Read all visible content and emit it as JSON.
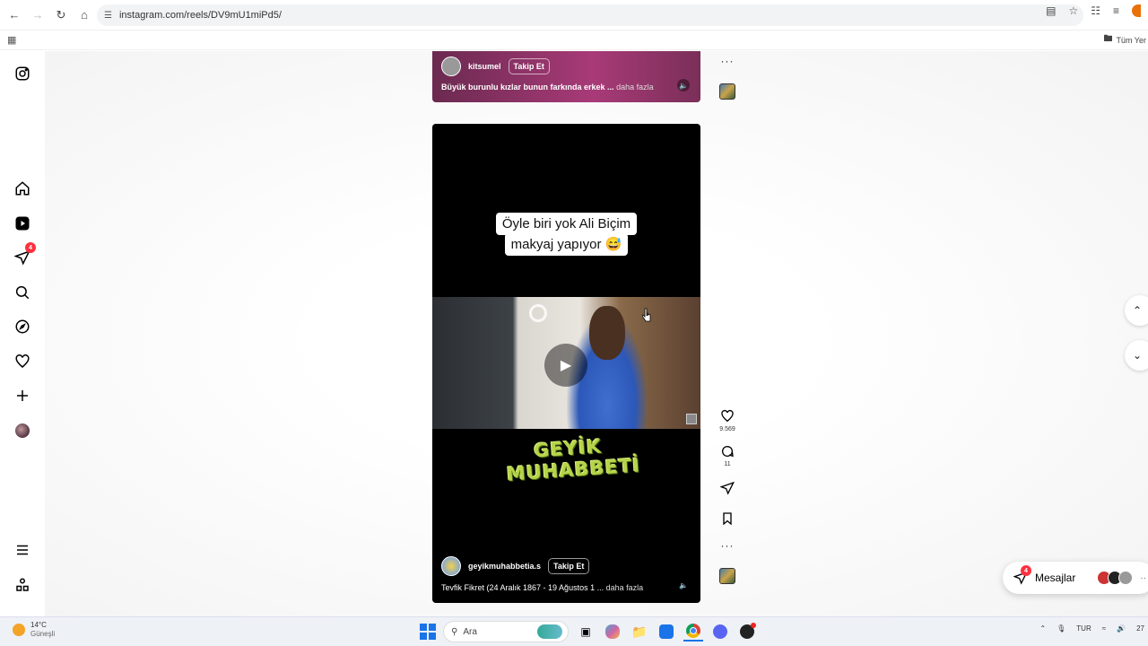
{
  "browser": {
    "url": "instagram.com/reels/DV9mU1miPd5/",
    "bookmarks_folder": "Tüm Yer"
  },
  "sidebar": {
    "notifications_badge": "4"
  },
  "prev_reel": {
    "username": "kitsumel",
    "follow_label": "Takip Et",
    "caption": "Büyük burunlu kızlar bunun farkında erkek ...",
    "more_label": "daha fazla"
  },
  "reel": {
    "overlay_line1": "Öyle biri yok Ali Biçim",
    "overlay_line2": "makyaj yapıyor 😅",
    "logo_line1": "GEYİK",
    "logo_line2": "MUHABBETİ",
    "username": "geyikmuhabbetia.s",
    "follow_label": "Takip Et",
    "caption": "Tevfik Fikret (24 Aralık 1867 - 19 Ağustos 1 ...",
    "more_label": "daha fazla"
  },
  "actions": {
    "likes": "9.569",
    "comments": "11"
  },
  "messages": {
    "label": "Mesajlar",
    "badge": "4"
  },
  "taskbar": {
    "temperature": "14°C",
    "condition": "Güneşli",
    "search_placeholder": "Ara",
    "language": "TUR",
    "clock_partial": "27"
  },
  "colors": {
    "badge_red": "#ff3040",
    "prev_reel_bg": "#a83a78",
    "reel_bg": "#000000"
  }
}
